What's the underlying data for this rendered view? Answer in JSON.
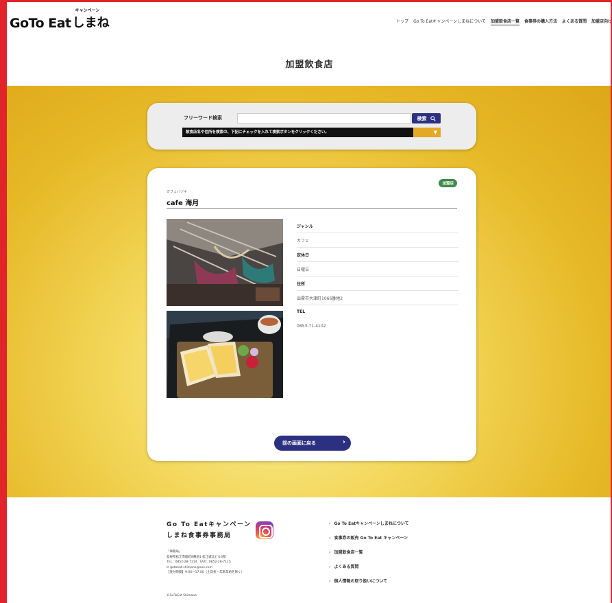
{
  "header": {
    "logo_main": "GoTo Eat",
    "logo_shimane": "しまね",
    "logo_sub": "キャンペーン",
    "nav": [
      "トップ",
      "Go To Eatキャンペーンしまねについて",
      "加盟飲食店一覧",
      "食事券の購入方法",
      "よくある質問",
      "加盟店向け"
    ],
    "page_title": "加盟飲食店"
  },
  "search": {
    "label": "フリーワード検索",
    "value": "",
    "button_label": "検索",
    "notice": "飲食店名や住所を検索の、下記にチェックを入れて検索ボタンをクリックください。",
    "arrow": "▼"
  },
  "store": {
    "badge": "加盟店",
    "furigana": "カフェハツキ",
    "name": "cafe 海月",
    "rows": [
      {
        "head": "ジャンル",
        "value": "カフェ"
      },
      {
        "head": "定休日",
        "value": "日曜日"
      },
      {
        "head": "住所",
        "value": "出雲市大津町1066番地2"
      },
      {
        "head": "TEL",
        "value": "0853-71-4102"
      }
    ],
    "back_label": "前の画面に戻る",
    "back_arrow": "›"
  },
  "footer": {
    "org_line1": "Go To Eatキャンペーン",
    "org_line2": "しまね食事券事務局",
    "address_lines": [
      "「事務局」",
      "島根県松江市殿町8番地1 松江城北ビル3階",
      "TEL：0852-28-7114　FAX：0852-28-7115",
      "✉ gotoeat-shimane@xxx.com",
      "【受付時間】9:00～17:00（土日祝・年末年始を除く）"
    ],
    "copyright": "©GoToEat Shimane",
    "links": [
      "Go To Eatキャンペーンしまねについて",
      "食事券の販売 Go To Eat キャンペーン",
      "加盟飲食店一覧",
      "よくある質問",
      "個人情報の取り扱いについて"
    ]
  },
  "icons": {
    "search": "search-icon",
    "instagram": "instagram-icon"
  }
}
